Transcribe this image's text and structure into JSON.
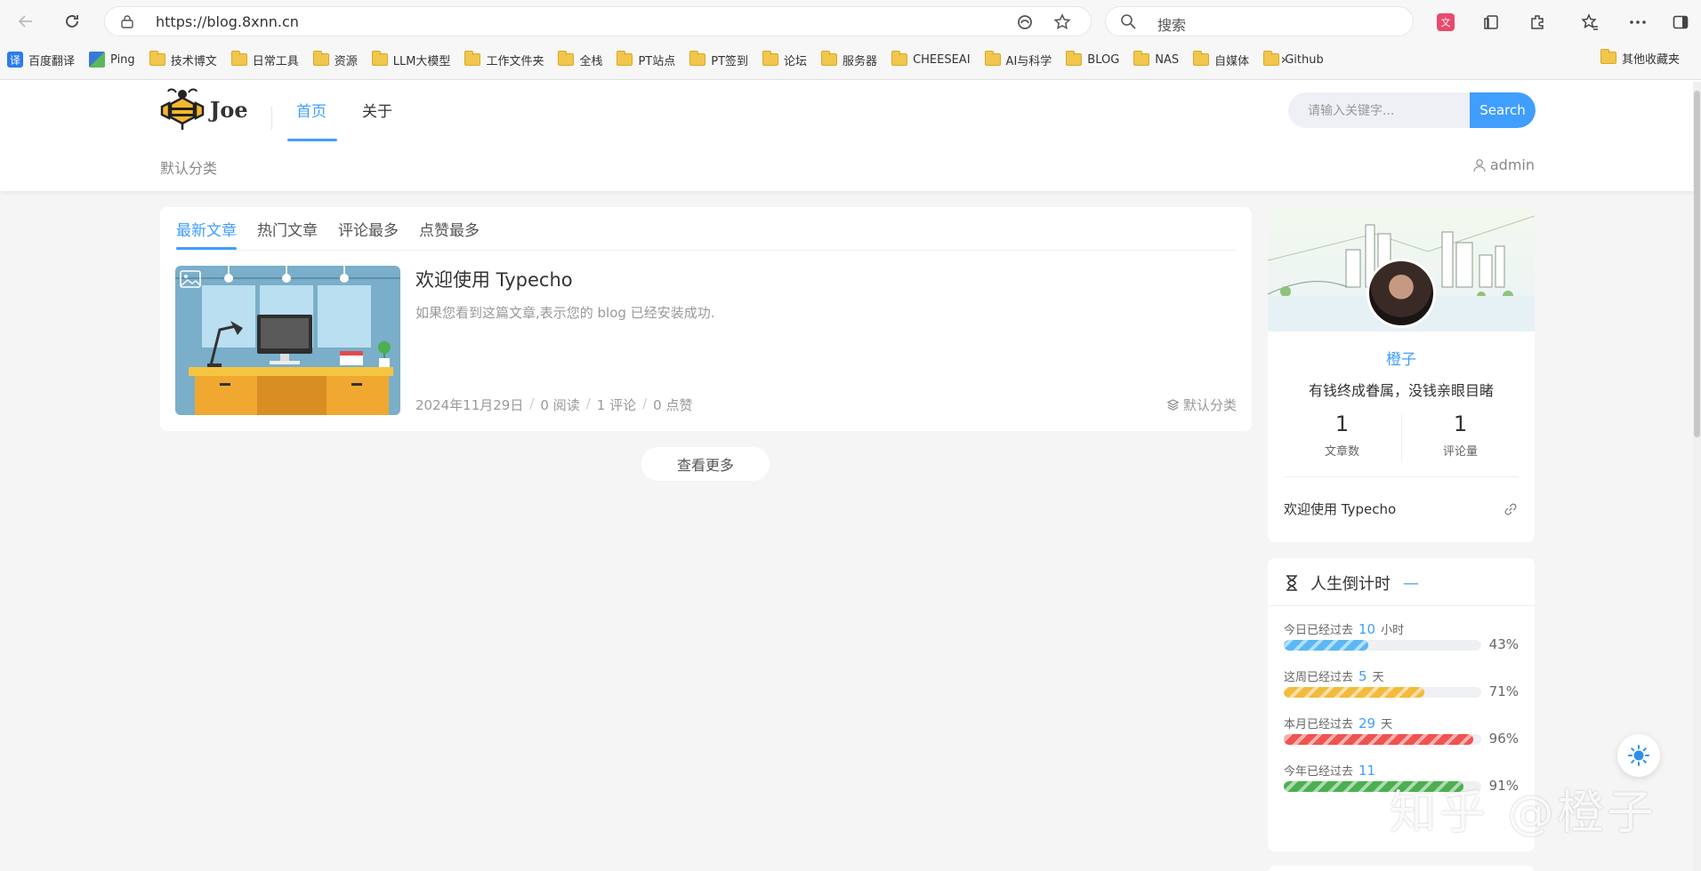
{
  "browser": {
    "url": "https://blog.8xnn.cn",
    "search_placeholder": "搜索",
    "bookmarks": [
      {
        "label": "百度翻译",
        "icon": "fanyi"
      },
      {
        "label": "Ping",
        "icon": "ping"
      },
      {
        "label": "技术博文",
        "icon": "folder"
      },
      {
        "label": "日常工具",
        "icon": "folder"
      },
      {
        "label": "资源",
        "icon": "folder"
      },
      {
        "label": "LLM大模型",
        "icon": "folder"
      },
      {
        "label": "工作文件夹",
        "icon": "folder"
      },
      {
        "label": "全栈",
        "icon": "folder"
      },
      {
        "label": "PT站点",
        "icon": "folder"
      },
      {
        "label": "PT签到",
        "icon": "folder"
      },
      {
        "label": "论坛",
        "icon": "folder"
      },
      {
        "label": "服务器",
        "icon": "folder"
      },
      {
        "label": "CHEESEAI",
        "icon": "folder"
      },
      {
        "label": "AI与科学",
        "icon": "folder"
      },
      {
        "label": "BLOG",
        "icon": "folder"
      },
      {
        "label": "NAS",
        "icon": "folder"
      },
      {
        "label": "自媒体",
        "icon": "folder"
      },
      {
        "label": "Github",
        "icon": "folder"
      }
    ],
    "other_bookmarks": "其他收藏夹"
  },
  "site": {
    "logo_text": "Joe",
    "nav": {
      "home": "首页",
      "about": "关于"
    },
    "search_placeholder": "请输入关键字...",
    "search_button": "Search",
    "sub_category": "默认分类",
    "admin": "admin"
  },
  "list": {
    "tabs": [
      "最新文章",
      "热门文章",
      "评论最多",
      "点赞最多"
    ],
    "post": {
      "title": "欢迎使用 Typecho",
      "excerpt": "如果您看到这篇文章,表示您的 blog 已经安装成功.",
      "date": "2024年11月29日",
      "reads": "0 阅读",
      "comments": "1 评论",
      "likes": "0 点赞",
      "category": "默认分类"
    },
    "load_more": "查看更多"
  },
  "author": {
    "name": "橙子",
    "motto": "有钱终成眷属，没钱亲眼目睹",
    "posts_count": "1",
    "posts_label": "文章数",
    "comments_count": "1",
    "comments_label": "评论量",
    "recent_post": "欢迎使用 Typecho"
  },
  "countdown": {
    "title": "人生倒计时",
    "dash": "—",
    "items": [
      {
        "prefix": "今日已经过去",
        "num": "10",
        "unit": "小时",
        "percent": 43,
        "pct_label": "43%",
        "color": "#5bb8f5"
      },
      {
        "prefix": "这周已经过去",
        "num": "5",
        "unit": "天",
        "percent": 71,
        "pct_label": "71%",
        "color": "#f3bb3b"
      },
      {
        "prefix": "本月已经过去",
        "num": "29",
        "unit": "天",
        "percent": 96,
        "pct_label": "96%",
        "color": "#ef5350"
      },
      {
        "prefix": "今年已经过去",
        "num": "11",
        "unit": "",
        "percent": 91,
        "pct_label": "91%",
        "color": "#4caf50"
      }
    ]
  },
  "watermark": "知乎 @橙子"
}
